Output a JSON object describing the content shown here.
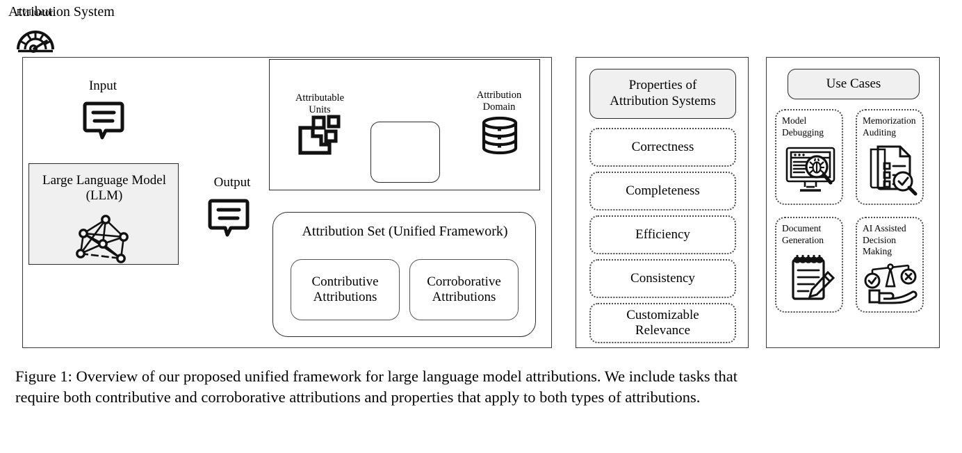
{
  "figure": {
    "caption_line1": "Figure 1: Overview of our proposed unified framework for large language model attributions. We include tasks that",
    "caption_line2": "require both contributive and corroborative attributions and properties that apply to both types of attributions."
  },
  "framework": {
    "input_label": "Input",
    "output_label": "Output",
    "llm_title": "Large Language\nModel (LLM)",
    "llm_title_line1": "Large Language",
    "llm_title_line2": "Model (LLM)",
    "attribution_system": {
      "title": "Attribution System",
      "attributable_units_label_line1": "Attributable",
      "attributable_units_label_line2": "Units",
      "attribution_domain_label_line1": "Attribution",
      "attribution_domain_label_line2": "Domain",
      "evaluator_label": "Evaluator"
    },
    "attribution_set": {
      "title": "Attribution Set (Unified Framework)",
      "items": [
        {
          "line1": "Contributive",
          "line2": "Attributions"
        },
        {
          "line1": "Corroborative",
          "line2": "Attributions"
        }
      ]
    }
  },
  "properties": {
    "header_line1": "Properties of",
    "header_line2": "Attribution Systems",
    "items": [
      {
        "line1": "Correctness",
        "line2": ""
      },
      {
        "line1": "Completeness",
        "line2": ""
      },
      {
        "line1": "Efficiency",
        "line2": ""
      },
      {
        "line1": "Consistency",
        "line2": ""
      },
      {
        "line1": "Customizable",
        "line2": "Relevance"
      }
    ]
  },
  "use_cases": {
    "header": "Use Cases",
    "items": [
      {
        "line1": "Model",
        "line2": "Debugging",
        "line3": "",
        "icon": "monitor-bug-magnifier-icon"
      },
      {
        "line1": "Memorization",
        "line2": "Auditing",
        "line3": "",
        "icon": "document-checklist-magnifier-icon"
      },
      {
        "line1": "Document",
        "line2": "Generation",
        "line3": "",
        "icon": "notepad-pencil-icon"
      },
      {
        "line1": "AI Assisted",
        "line2": "Decision",
        "line3": "Making",
        "icon": "scales-hand-icon"
      }
    ]
  },
  "colors": {
    "panel_border": "#3a3a3a",
    "box_border": "#2b2b2b",
    "fill_gray": "#f0f0f0",
    "background": "#ffffff",
    "ink": "#000000"
  }
}
